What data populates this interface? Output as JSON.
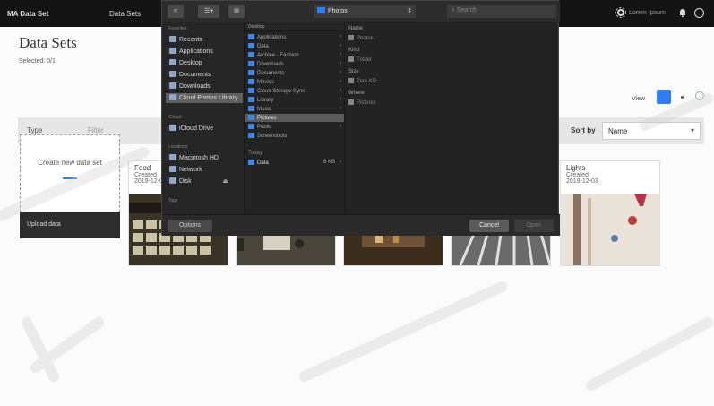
{
  "topbar": {
    "brand": "MA Data Set",
    "nav_item": "Data Sets",
    "username": "Lorem Ipsum"
  },
  "page": {
    "title": "Data Sets",
    "selected": "Selected: 0/1"
  },
  "view": {
    "label": "View"
  },
  "filter": {
    "field1": "Type",
    "field2": "Filter",
    "sort_label": "Sort by",
    "sort_value": "Name"
  },
  "cards": {
    "add_text": "Create new data set",
    "upload_label": "Upload data",
    "items": [
      {
        "name": "Food",
        "date": "Created",
        "date2": "2019-12-03"
      },
      {
        "name": "",
        "date": "",
        "date2": ""
      },
      {
        "name": "",
        "date": "",
        "date2": ""
      },
      {
        "name": "",
        "date": "",
        "date2": ""
      },
      {
        "name": "Lights",
        "date": "Created",
        "date2": "2019-12-03"
      }
    ]
  },
  "dialog": {
    "toolbar": {
      "back": "<",
      "view": "☰▾",
      "newfolder": "⊞"
    },
    "location": "Photos",
    "search_placeholder": "Search",
    "sidebar": {
      "favorites_heading": "Favorites",
      "favorites": [
        "Recents",
        "Applications",
        "Desktop",
        "Documents",
        "Downloads",
        "Cloud Photos Library"
      ],
      "icloud_heading": "iCloud",
      "icloud": [
        "iCloud Drive"
      ],
      "locations_heading": "Locations",
      "locations": [
        "Macintosh HD",
        "Network",
        "Disk"
      ],
      "tags_heading": "Tags"
    },
    "col1": {
      "heading": "Desktop",
      "rows": [
        "Applications",
        "Data",
        "Archive - Fashion",
        "Downloads",
        "Documents",
        "Movies",
        "Cloud Storage Sync",
        "Library",
        "Music",
        "Pictures",
        "Public",
        "Screenshots"
      ],
      "selected_index": 9
    },
    "col1b": {
      "heading": "Today",
      "rows": [
        {
          "name": "Data",
          "size": "8 KB"
        }
      ]
    },
    "preview": {
      "name_label": "Name",
      "name_value": "Photos",
      "kind_label": "Kind",
      "kind_value": "Folder",
      "size_label": "Size",
      "size_value": "Zero KB",
      "where_label": "Where",
      "where_value": "Pictures"
    },
    "footer": {
      "options": "Options",
      "cancel": "Cancel",
      "open": "Open"
    }
  }
}
